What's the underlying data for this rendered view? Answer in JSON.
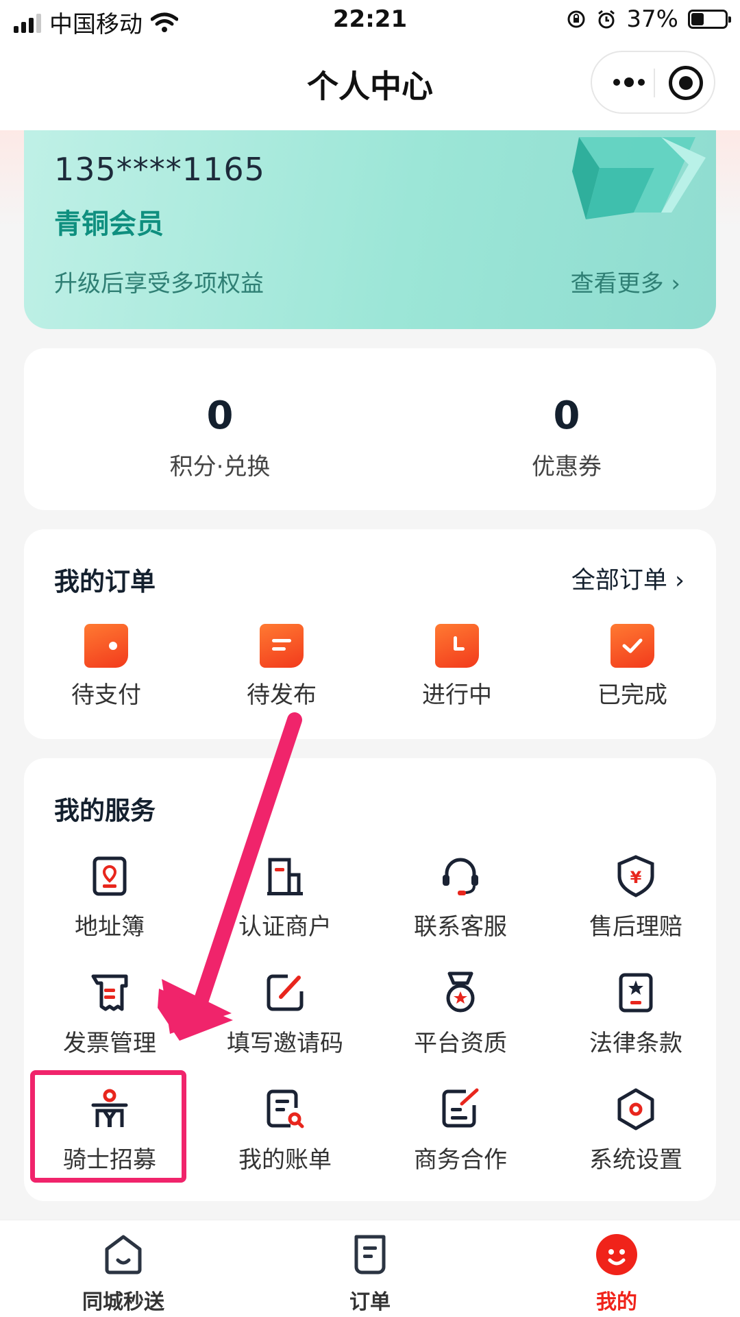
{
  "status_bar": {
    "carrier": "中国移动",
    "time": "22:21",
    "battery_percent_text": "37%",
    "battery_level": 0.37
  },
  "nav": {
    "title": "个人中心"
  },
  "member": {
    "phone": "135****1165",
    "level": "青铜会员",
    "tip": "升级后享受多项权益",
    "more": "查看更多 ›"
  },
  "stats": [
    {
      "value": "0",
      "label": "积分·兑换"
    },
    {
      "value": "0",
      "label": "优惠券"
    }
  ],
  "orders": {
    "title": "我的订单",
    "all_link": "全部订单 ›",
    "items": [
      {
        "label": "待支付",
        "icon": "wallet-icon"
      },
      {
        "label": "待发布",
        "icon": "document-icon"
      },
      {
        "label": "进行中",
        "icon": "clock-icon"
      },
      {
        "label": "已完成",
        "icon": "check-icon"
      }
    ]
  },
  "services": {
    "title": "我的服务",
    "items": [
      {
        "label": "地址簿",
        "icon": "location-book-icon"
      },
      {
        "label": "认证商户",
        "icon": "merchant-icon"
      },
      {
        "label": "联系客服",
        "icon": "headset-icon"
      },
      {
        "label": "售后理赔",
        "icon": "shield-yuan-icon"
      },
      {
        "label": "发票管理",
        "icon": "invoice-icon"
      },
      {
        "label": "填写邀请码",
        "icon": "edit-icon"
      },
      {
        "label": "平台资质",
        "icon": "medal-icon"
      },
      {
        "label": "法律条款",
        "icon": "star-document-icon"
      },
      {
        "label": "骑士招募",
        "icon": "rider-icon"
      },
      {
        "label": "我的账单",
        "icon": "bill-search-icon"
      },
      {
        "label": "商务合作",
        "icon": "contract-icon"
      },
      {
        "label": "系统设置",
        "icon": "settings-hexagon-icon"
      }
    ]
  },
  "tabs": [
    {
      "label": "同城秒送",
      "icon": "home-face-icon"
    },
    {
      "label": "订单",
      "icon": "order-list-icon"
    },
    {
      "label": "我的",
      "icon": "profile-face-icon",
      "active": true
    }
  ],
  "colors": {
    "accent": "#f0231a",
    "member_card": "#9ce6d7",
    "highlight": "#f0246b"
  }
}
